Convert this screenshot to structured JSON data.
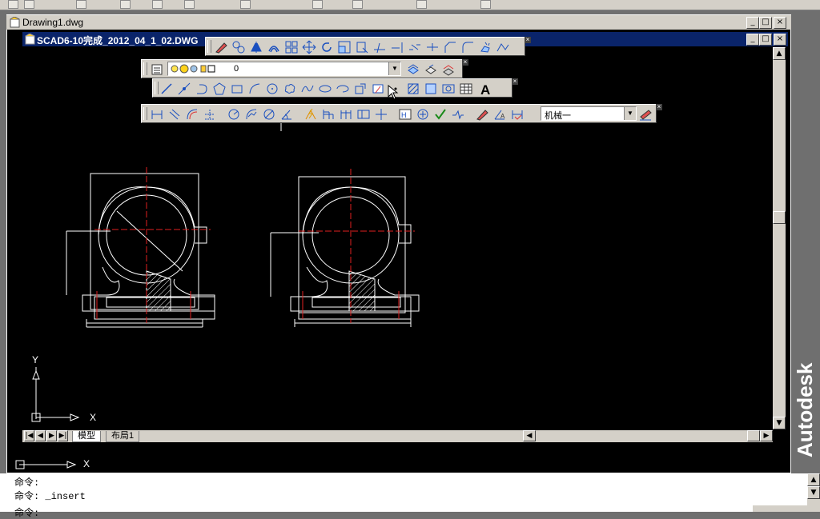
{
  "windows": {
    "background_title": "Drawing1.dwg",
    "drawing_title": "SCAD6-10完成_2012_04_1_02.DWG"
  },
  "toolbars": {
    "layer_value": "0",
    "dimstyle_value": "机械一"
  },
  "layout_tabs": [
    "模型",
    "布局1"
  ],
  "axis_labels": {
    "x": "X",
    "y": "Y"
  },
  "command_lines": [
    "命令:",
    "命令: _insert",
    "命令:"
  ],
  "brand": "Autodesk"
}
